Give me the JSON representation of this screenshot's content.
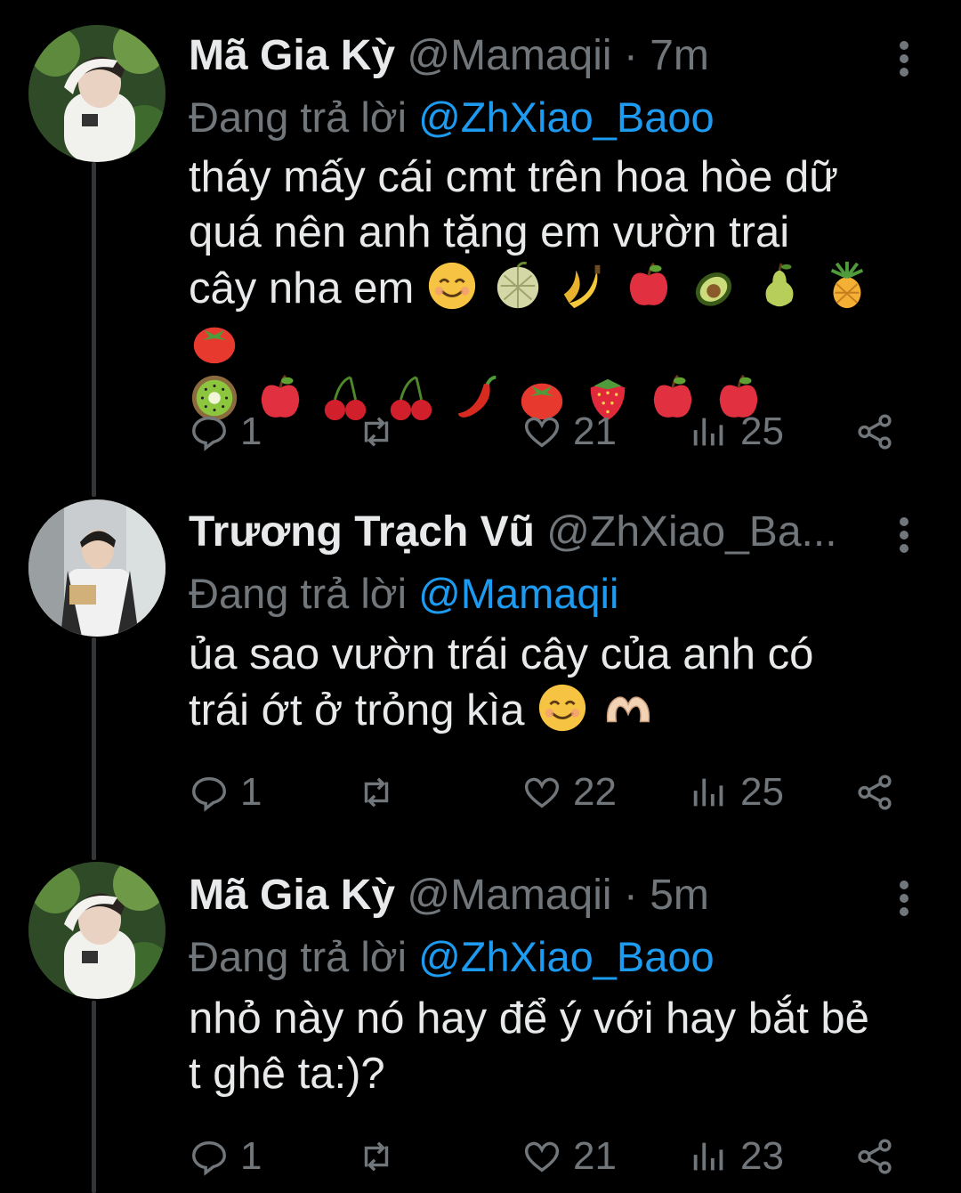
{
  "tweets": [
    {
      "author_name": "Mã Gia Kỳ",
      "author_handle": "@Mamaqii",
      "separator": "·",
      "time": "7m",
      "replying_prefix": "Đang trả lời",
      "replying_to": "@ZhXiao_Baoo",
      "text_lines": [
        "tháy mấy cái cmt trên hoa hòe dữ",
        "quá nên anh tặng em vườn trai",
        "cây nha em"
      ],
      "emojis_line3": [
        "smiling-face",
        "melon",
        "banana",
        "red-apple",
        "avocado",
        "pear",
        "pineapple",
        "tomato"
      ],
      "emojis_line4": [
        "kiwi",
        "red-apple",
        "cherries",
        "cherries",
        "hot-pepper",
        "tomato",
        "strawberry",
        "red-apple",
        "red-apple"
      ],
      "replies": "1",
      "retweets": "",
      "likes": "21",
      "views": "25"
    },
    {
      "author_name": "Trương Trạch Vũ",
      "author_handle": "@ZhXiao_Ba...",
      "replying_prefix": "Đang trả lời",
      "replying_to": "@Mamaqii",
      "text_lines": [
        "ủa sao vườn trái cây của anh có",
        "trái ớt ở trỏng kìa"
      ],
      "emojis_line2": [
        "smiling-face",
        "heart-hands"
      ],
      "replies": "1",
      "retweets": "",
      "likes": "22",
      "views": "25"
    },
    {
      "author_name": "Mã Gia Kỳ",
      "author_handle": "@Mamaqii",
      "separator": "·",
      "time": "5m",
      "replying_prefix": "Đang trả lời",
      "replying_to": "@ZhXiao_Baoo",
      "text_lines": [
        "nhỏ này nó hay để ý với hay bắt bẻ",
        "t ghê ta:)?"
      ],
      "replies": "1",
      "retweets": "",
      "likes": "21",
      "views": "23"
    }
  ],
  "colors": {
    "background": "#000000",
    "text": "#e7e9ea",
    "muted": "#71767b",
    "mention": "#1d9bf0",
    "thread_line": "#333639"
  },
  "icons": [
    "reply-icon",
    "retweet-icon",
    "like-icon",
    "views-icon",
    "share-icon",
    "more-icon"
  ]
}
